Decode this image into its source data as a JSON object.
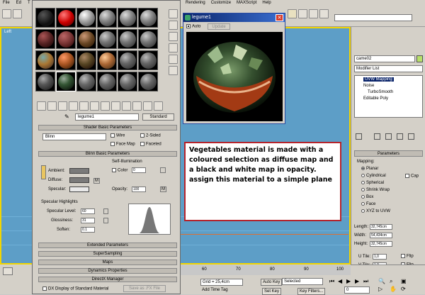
{
  "menu": [
    "File",
    "Ed",
    "T",
    "Rendering",
    "Customize",
    "MAXScript",
    "Help"
  ],
  "material_editor": {
    "material_name": "legume1",
    "material_type": "Standard",
    "shader_basic_parameters": {
      "title": "Shader Basic Parameters",
      "shader": "Blinn",
      "wire": "Wire",
      "two_sided": "2-Sided",
      "face_map": "Face Map",
      "faceted": "Faceted"
    },
    "blinn_basic_parameters": {
      "title": "Blinn Basic Parameters",
      "self_illumination": "Self-Illumination",
      "color_label": "Color",
      "color_value": "0",
      "ambient": "Ambient:",
      "diffuse": "Diffuse:",
      "specular": "Specular:",
      "opacity_label": "Opacity:",
      "opacity_value": "100",
      "map_letter": "M"
    },
    "specular_highlights": {
      "title": "Specular Highlights",
      "specular_level_label": "Specular Level:",
      "specular_level": "60",
      "glossiness_label": "Glossiness:",
      "glossiness": "31",
      "soften_label": "Soften:",
      "soften": "0.1"
    },
    "rollouts": [
      "Extended Parameters",
      "SuperSampling",
      "Maps",
      "Dynamics Properties",
      "DirectX Manager"
    ],
    "dx_display": "DX Display of Standard Material",
    "save_fx": "Save as .FX File"
  },
  "preview_window": {
    "title": "legume1",
    "auto": "Auto",
    "update": "Update"
  },
  "annotation": {
    "text": "Vegetables material is made with a coloured selection as diffuse map and a black and white map in opacity. assign this material to a simple plane"
  },
  "command_panel": {
    "object_name": "came02",
    "modifier_list": "Modifier List",
    "stack": [
      "UVW Mapping",
      "Noise",
      "TurboSmooth",
      "Editable Poly"
    ],
    "parameters_title": "Parameters",
    "mapping_label": "Mapping:",
    "mapping_options": [
      "Planar",
      "Cylindrical",
      "Spherical",
      "Shrink Wrap",
      "Box",
      "Face",
      "XYZ to UVW"
    ],
    "cap": "Cap",
    "length_label": "Length:",
    "length": "32,745cm",
    "width_label": "Width:",
    "width": "54,434cm",
    "height_label": "Height:",
    "height": "32,745cm",
    "u_tile_label": "U Tile:",
    "u_tile": "1,0",
    "v_tile_label": "V Tile:",
    "v_tile": "1,0",
    "flip": "Flip"
  },
  "viewport": {
    "label": "Left"
  },
  "status": {
    "grid": "Grid = 25,4cm",
    "add_time_tag": "Add Time Tag",
    "auto_key": "Auto Key",
    "set_key": "Set Key",
    "selected": "Selected",
    "key_filters": "Key Filters...",
    "frame": "0",
    "ticks": [
      "60",
      "70",
      "80",
      "90",
      "100"
    ]
  }
}
